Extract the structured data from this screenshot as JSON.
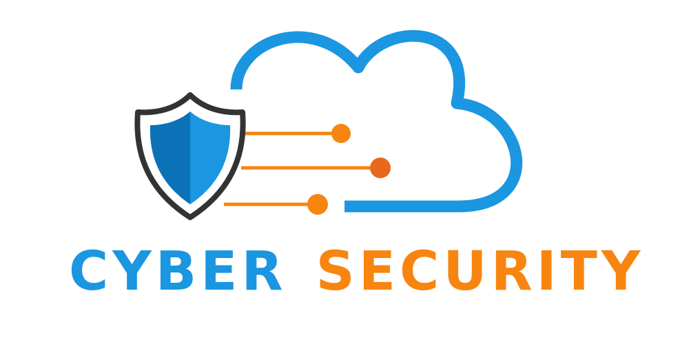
{
  "logo": {
    "word_1": "CYBER",
    "word_2": "SECURITY"
  },
  "colors": {
    "cloud": "#1b96e0",
    "shield_light": "#1b96e0",
    "shield_dark": "#0b72b8",
    "shield_outline": "#333333",
    "circuit": "#f7850f",
    "circuit_dot_mid": "#e8681c",
    "word_1": "#1b96e0",
    "word_2": "#f7850f"
  },
  "icons": [
    "cloud-icon",
    "shield-icon",
    "circuit-lines-icon"
  ]
}
